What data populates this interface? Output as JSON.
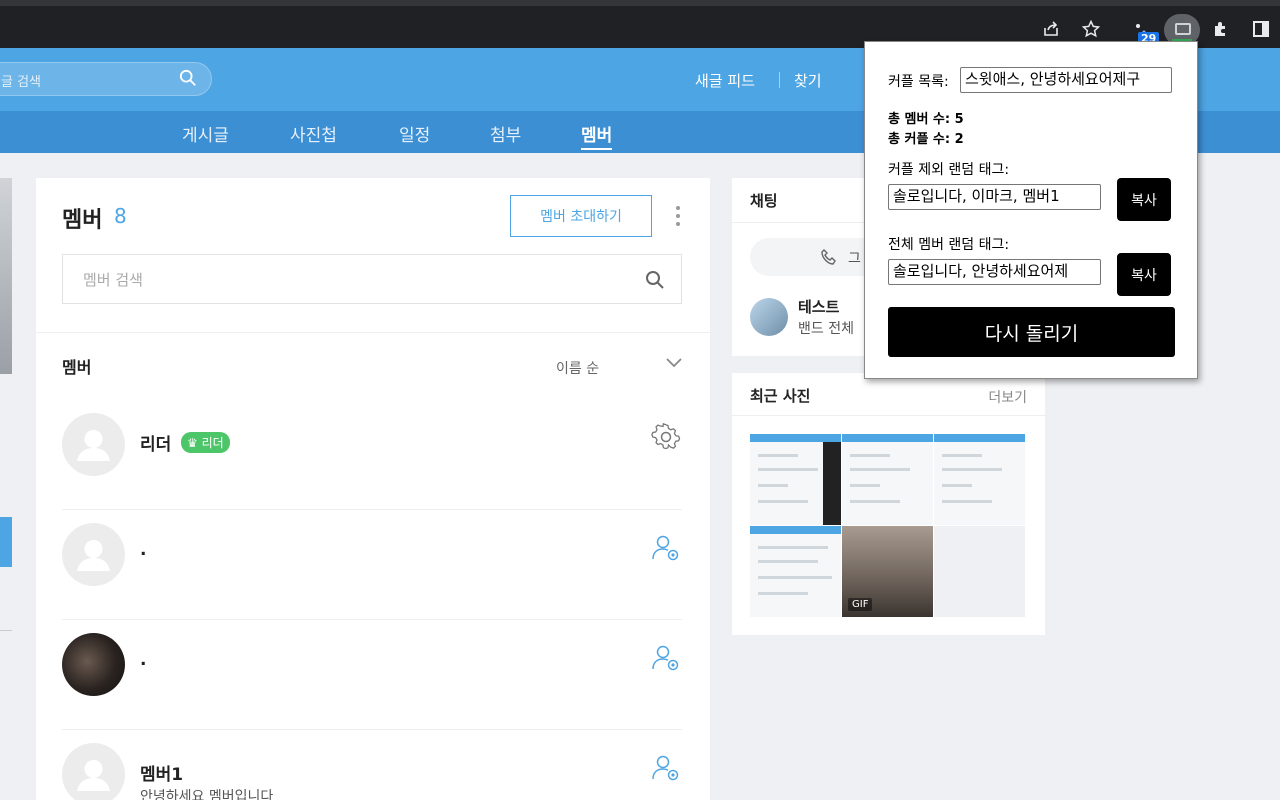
{
  "browser": {
    "extension_badge": "29",
    "icons": [
      "share-icon",
      "star-icon",
      "extension-icon-1",
      "extension-icon-active",
      "puzzle-icon",
      "sidepanel-icon"
    ]
  },
  "header": {
    "search_placeholder": "글 검색",
    "links": [
      "새글 피드",
      "찾기"
    ]
  },
  "tabs": [
    "게시글",
    "사진첩",
    "일정",
    "첨부",
    "멤버"
  ],
  "active_tab": "멤버",
  "members_panel": {
    "title": "멤버",
    "count": "8",
    "invite_button": "멤버 초대하기",
    "search_placeholder": "멤버 검색",
    "list_heading": "멤버",
    "sort_label": "이름 순",
    "rows": [
      {
        "name": "리더",
        "badge": "리더",
        "sub": ""
      },
      {
        "name": ".",
        "sub": ""
      },
      {
        "name": ".",
        "sub": ""
      },
      {
        "name": "멤버1",
        "sub": "안녕하세요 멤버입니다"
      }
    ]
  },
  "chat": {
    "title": "채팅",
    "pill_text": "그",
    "name": "테스트",
    "message": "밴드 전체"
  },
  "photos": {
    "title": "최근 사진",
    "more": "더보기",
    "gif_badge": "GIF"
  },
  "popup": {
    "couple_list_label": "커플 목록:",
    "couple_list_value": "스윗애스, 안녕하세요어제구",
    "total_members": "총 멤버 수: 5",
    "total_couples": "총 커플 수: 2",
    "excl_label": "커플 제외 랜덤 태그:",
    "excl_value": "솔로입니다, 이마크, 멤버1",
    "all_label": "전체 멤버 랜덤 태그:",
    "all_value": "솔로입니다, 안녕하세요어제",
    "copy_label": "복사",
    "rerun_label": "다시 돌리기"
  },
  "colors": {
    "brand_blue": "#4ea5e4",
    "tab_blue": "#3d8fd4",
    "leader_green": "#4dc66a"
  }
}
